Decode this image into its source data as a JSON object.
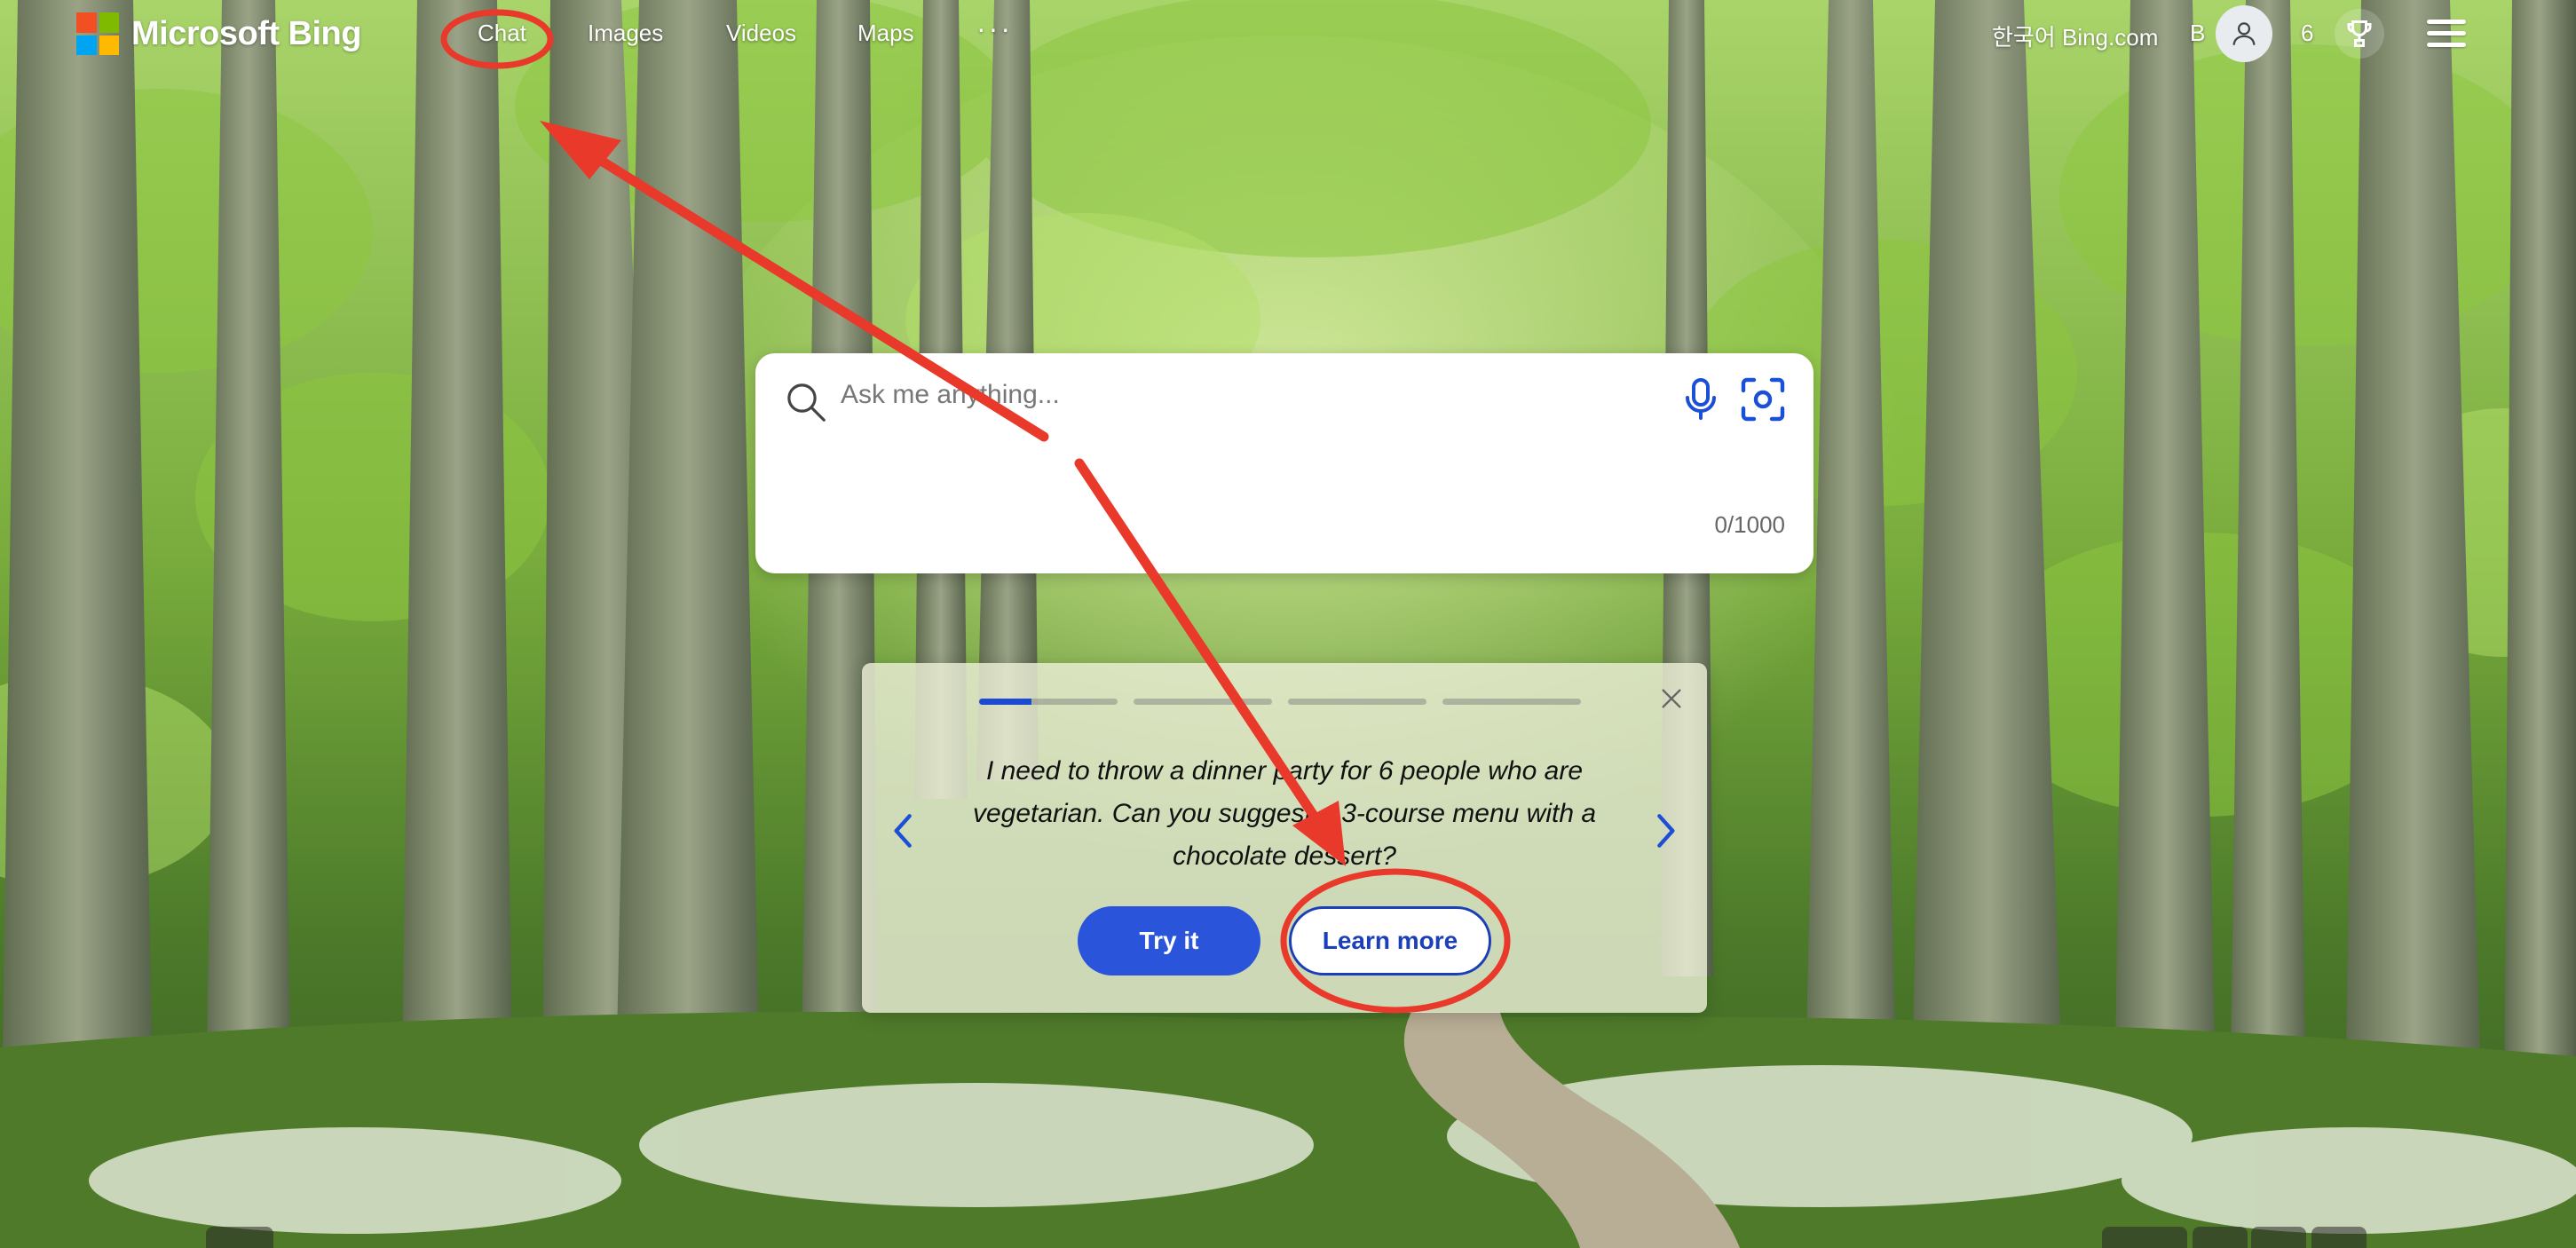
{
  "header": {
    "logo_text": "Microsoft Bing",
    "nav": [
      {
        "label": "Chat"
      },
      {
        "label": "Images"
      },
      {
        "label": "Videos"
      },
      {
        "label": "Maps"
      }
    ],
    "more_label": "···",
    "language_link": "한국어 Bing.com",
    "user_initial": "B",
    "reward_points": "6"
  },
  "search": {
    "placeholder": "Ask me anything...",
    "char_count": "0/1000"
  },
  "suggestion_card": {
    "active_step": 1,
    "step_count": 4,
    "active_fill": 0.38,
    "text": "I need to throw a dinner party for 6 people who are vegetarian. Can you suggest a 3-course menu with a chocolate dessert?",
    "try_label": "Try it",
    "learn_label": "Learn more"
  },
  "colors": {
    "brand_blue": "#2a55db",
    "annotation_red": "#e8392a",
    "ms_red": "#f25022",
    "ms_green": "#7fba00",
    "ms_blue": "#00a4ef",
    "ms_yellow": "#ffb900"
  }
}
